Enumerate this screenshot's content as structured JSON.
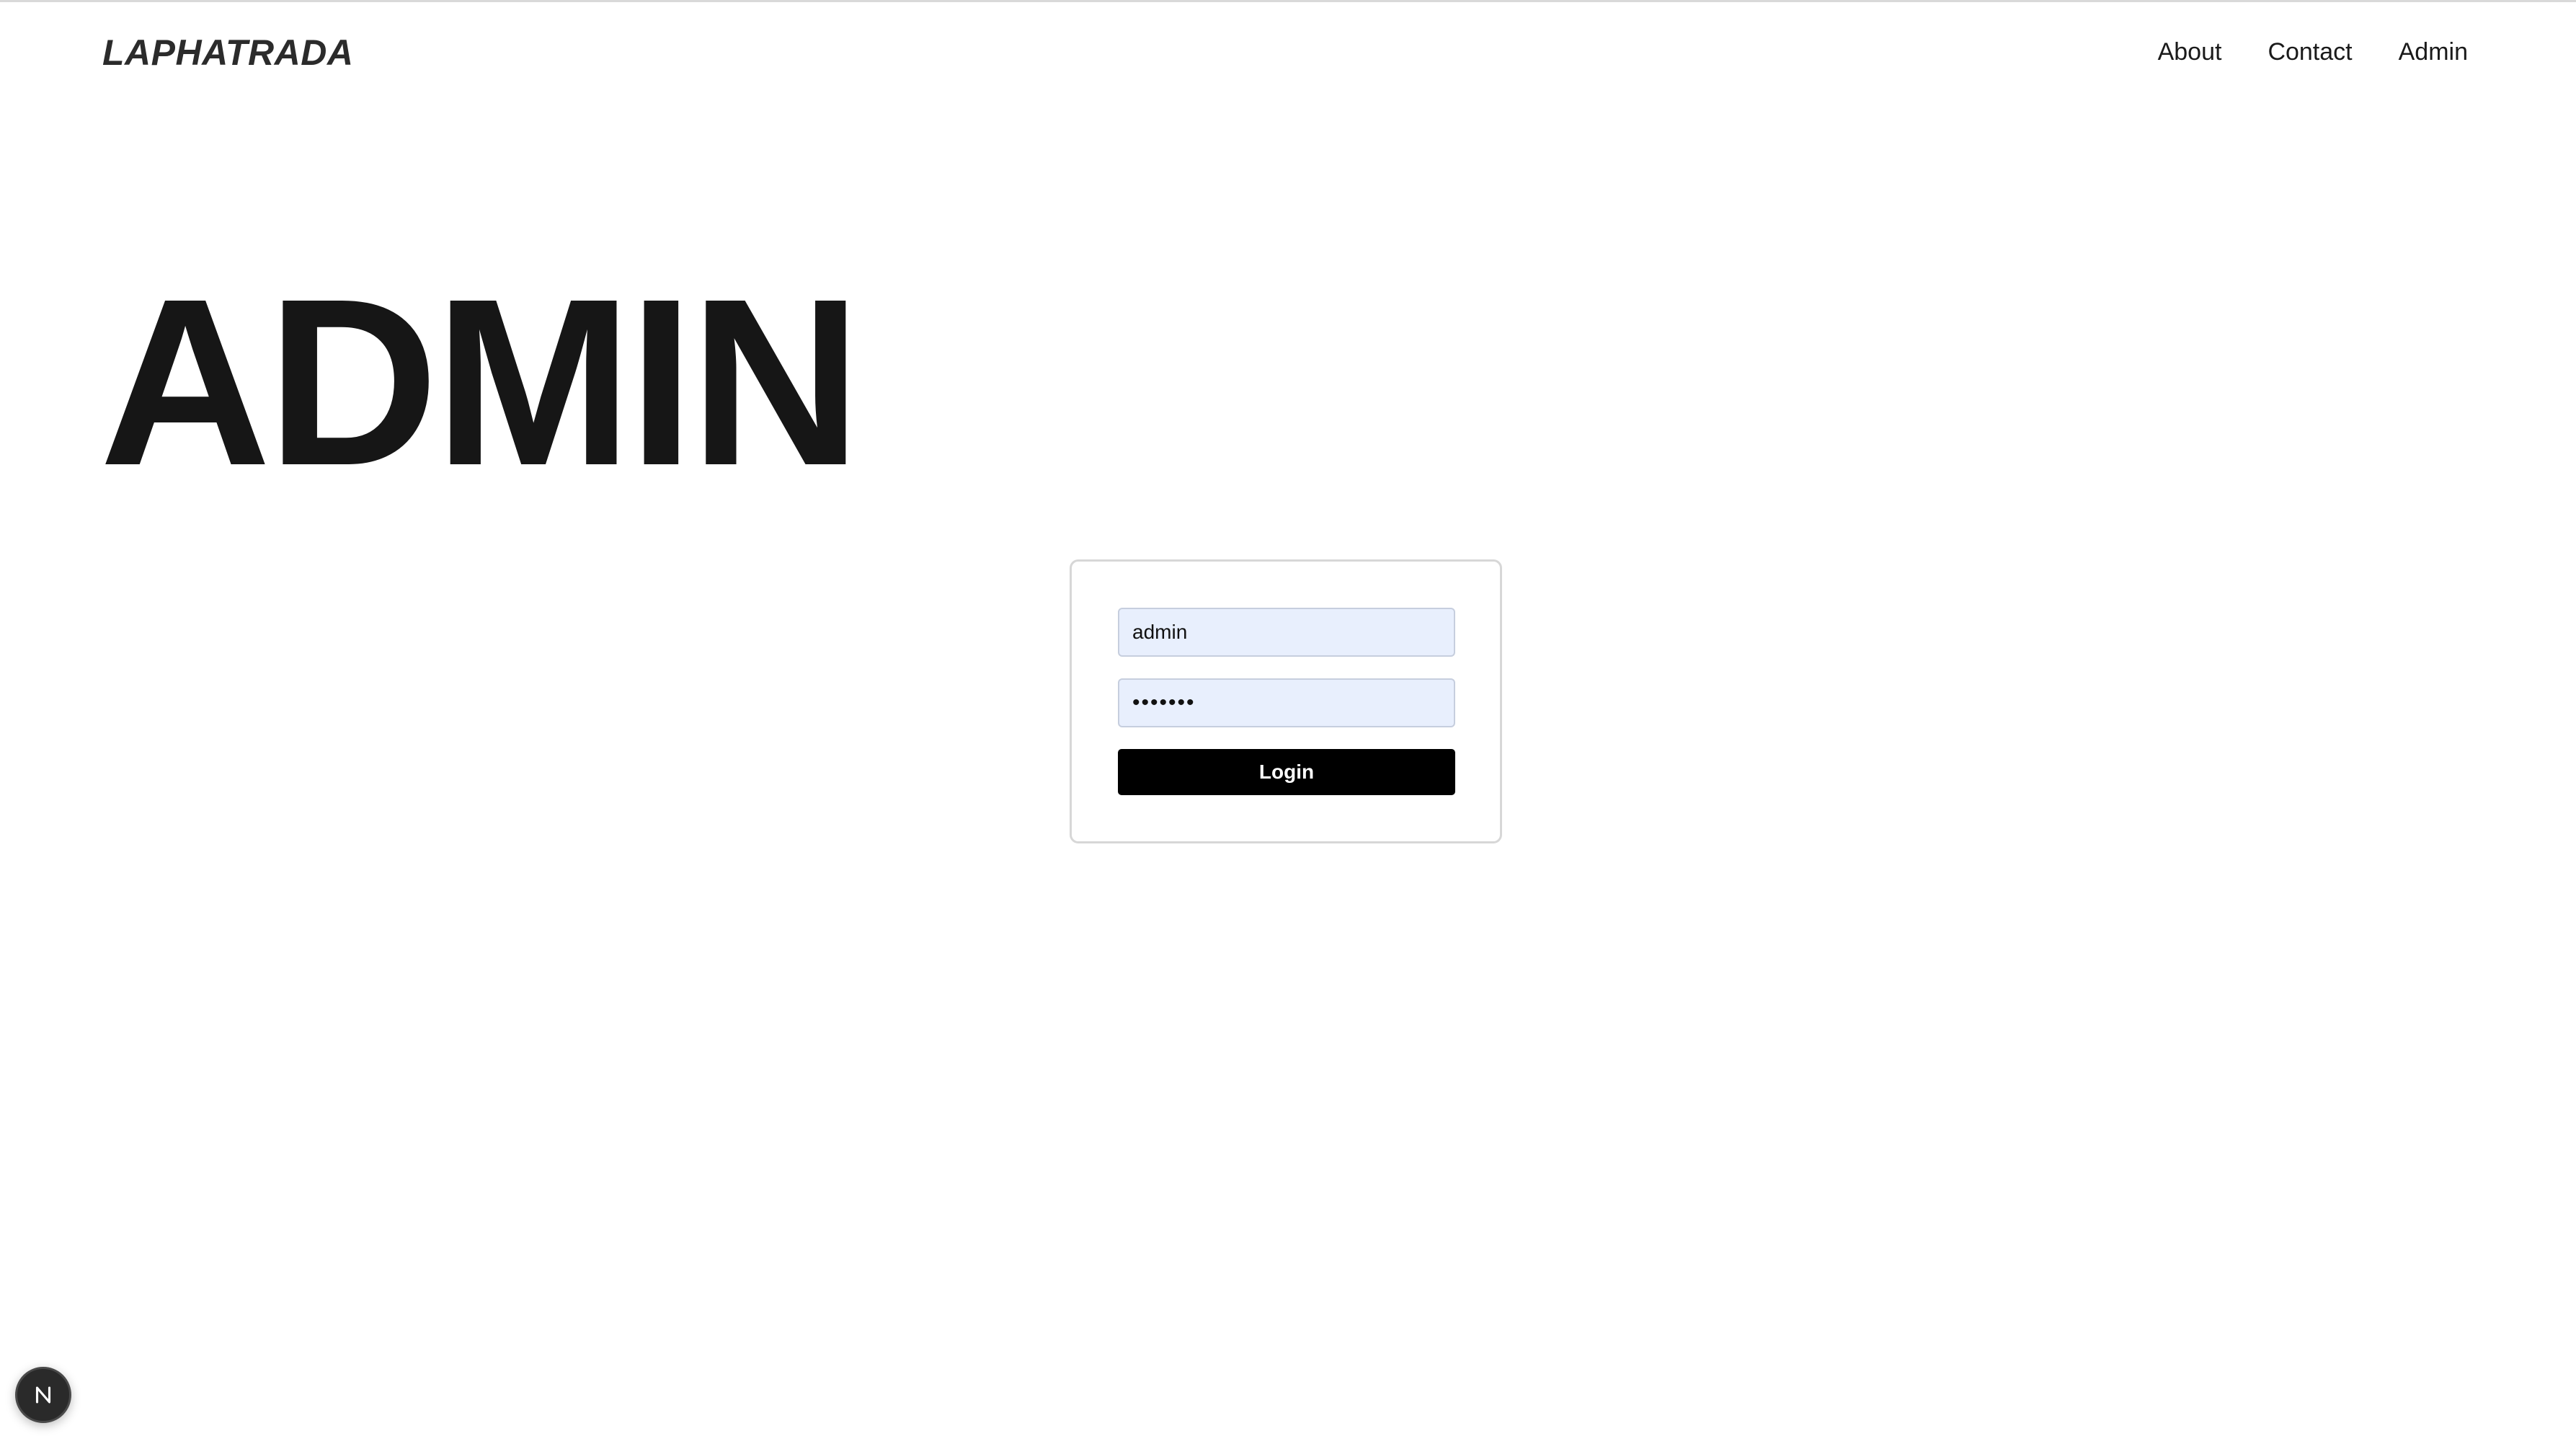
{
  "header": {
    "logo": "LAPHATRADA",
    "nav": [
      {
        "label": "About"
      },
      {
        "label": "Contact"
      },
      {
        "label": "Admin"
      }
    ]
  },
  "main": {
    "heading": "ADMIN"
  },
  "login": {
    "username_value": "admin",
    "password_value": "1234567",
    "button_label": "Login"
  },
  "dev_badge": {
    "icon": "nextjs-n-icon",
    "color": "#2a2a2a"
  },
  "colors": {
    "input_fill": "#e8effd",
    "button_fill": "#000000",
    "text": "#1a1a1a"
  }
}
